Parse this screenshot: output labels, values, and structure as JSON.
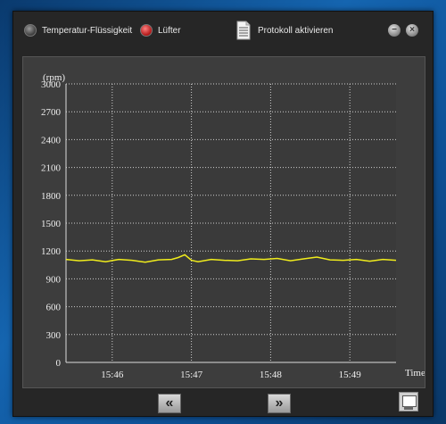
{
  "toolbar": {
    "radio_temperature_label": "Temperatur-Flüssigkeit",
    "radio_fan_label": "Lüfter",
    "protocol_label": "Protokoll aktivieren",
    "minimize_glyph": "−",
    "close_glyph": "×"
  },
  "navigation": {
    "prev_glyph": "«",
    "next_glyph": "»"
  },
  "colors": {
    "series": "#f0ec1c",
    "grid": "#cfcfcf",
    "active_radio": "#d01c1c"
  },
  "chart_data": {
    "type": "line",
    "title": "",
    "ylabel": "(rpm)",
    "xlabel": "Time",
    "ylim": [
      0,
      3000
    ],
    "yticks": [
      "0",
      "300",
      "600",
      "900",
      "1200",
      "1500",
      "1800",
      "2100",
      "2400",
      "2700",
      "3000"
    ],
    "xlim": [
      "15:45:25",
      "15:49:35"
    ],
    "xticks": [
      "15:46",
      "15:47",
      "15:48",
      "15:49"
    ],
    "grid": true,
    "series": [
      {
        "x": [
          "15:45:25",
          "15:45:35",
          "15:45:45",
          "15:45:55",
          "15:46:05",
          "15:46:15",
          "15:46:25",
          "15:46:35",
          "15:46:45",
          "15:46:50",
          "15:46:55",
          "15:47:00",
          "15:47:05",
          "15:47:15",
          "15:47:25",
          "15:47:35",
          "15:47:45",
          "15:47:55",
          "15:48:05",
          "15:48:15",
          "15:48:25",
          "15:48:35",
          "15:48:45",
          "15:48:55",
          "15:49:05",
          "15:49:15",
          "15:49:25",
          "15:49:35"
        ],
        "values": [
          1110,
          1095,
          1105,
          1085,
          1110,
          1100,
          1080,
          1105,
          1110,
          1130,
          1160,
          1100,
          1085,
          1110,
          1100,
          1095,
          1115,
          1110,
          1120,
          1095,
          1115,
          1135,
          1105,
          1100,
          1110,
          1090,
          1110,
          1100
        ]
      }
    ]
  }
}
